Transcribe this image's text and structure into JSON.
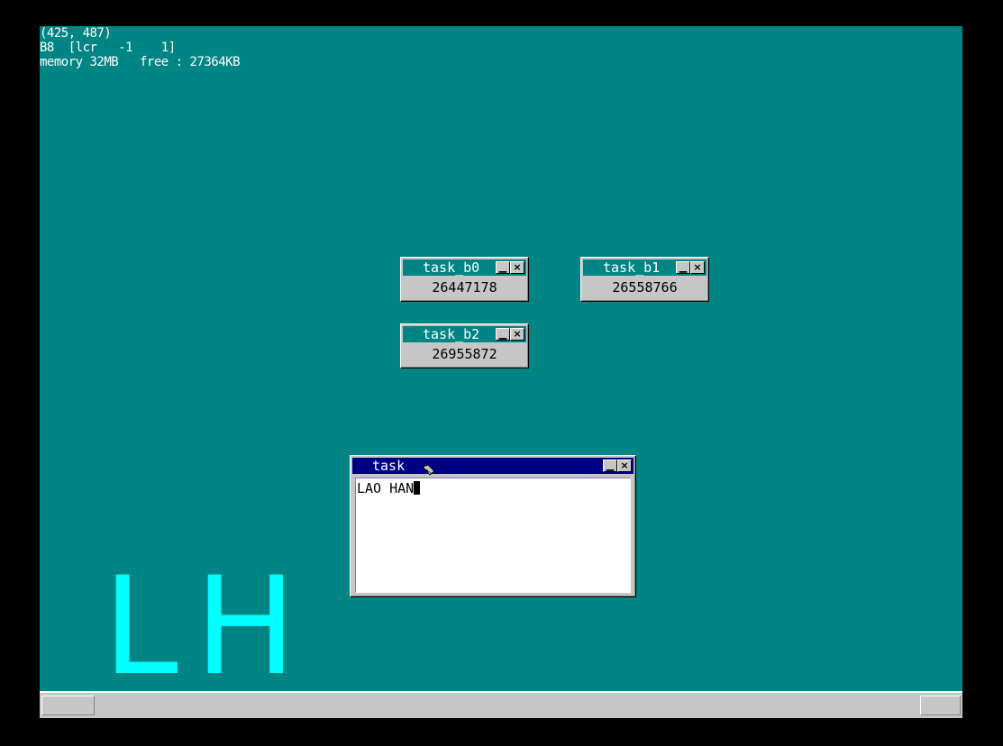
{
  "debug": {
    "mouse_coords": "(425, 487)",
    "key_line": "B8  [lcr   -1    1]",
    "memory_line": "memory 32MB   free : 27364KB"
  },
  "windows": [
    {
      "title": "task_b0",
      "value": "26447178",
      "minimize": "▁",
      "close": "×"
    },
    {
      "title": "task_b1",
      "value": "26558766",
      "minimize": "▁",
      "close": "×"
    },
    {
      "title": "task_b2",
      "value": "26955872",
      "minimize": "▁",
      "close": "×"
    }
  ],
  "console_window": {
    "title": "task",
    "text": "LAO HAN",
    "minimize": "▁",
    "close": "×"
  },
  "logo": {
    "letter1": "L",
    "letter2": "H"
  },
  "colors": {
    "desktop": "#008484",
    "active_title": "#000084",
    "inactive_title": "#008484",
    "logo": "#00ffff"
  }
}
